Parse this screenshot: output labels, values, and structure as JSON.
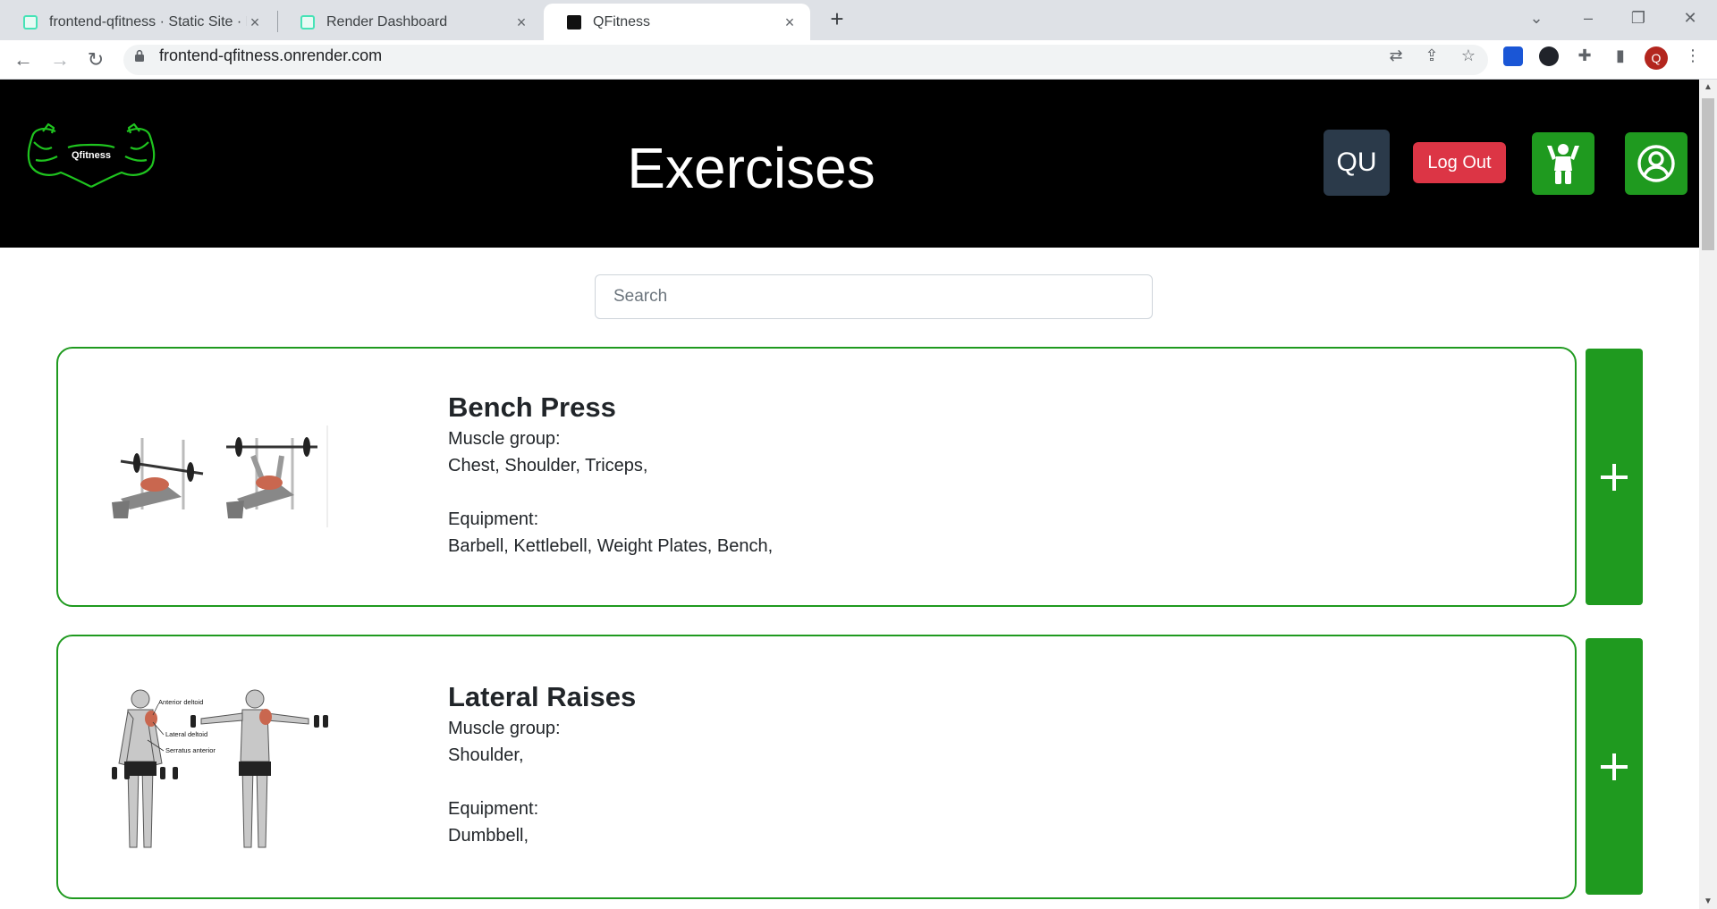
{
  "browser": {
    "tabs": [
      {
        "title": "frontend-qfitness · Static Site · R",
        "active": false
      },
      {
        "title": "Render Dashboard",
        "active": false
      },
      {
        "title": "QFitness",
        "active": true
      }
    ],
    "url": "frontend-qfitness.onrender.com",
    "profile_initial": "Q"
  },
  "header": {
    "logo_text": "Qfitness",
    "title": "Exercises",
    "user_initials": "QU",
    "logout_label": "Log Out"
  },
  "search": {
    "placeholder": "Search",
    "value": ""
  },
  "labels": {
    "muscle_group": "Muscle group:",
    "equipment": "Equipment:",
    "add": "+"
  },
  "exercises": [
    {
      "name": "Bench Press",
      "muscles": "Chest, Shoulder, Triceps,",
      "equipment": "Barbell, Kettlebell, Weight Plates, Bench,"
    },
    {
      "name": "Lateral Raises",
      "muscles": "Shoulder,",
      "equipment": "Dumbbell,",
      "image_labels": [
        "Anterior deltoid",
        "Lateral deltoid",
        "Serratus anterior"
      ]
    }
  ],
  "colors": {
    "brand_green": "#1f9a1f",
    "danger": "#dc3545",
    "header_bg": "#000000",
    "user_btn": "#2b3a4a"
  }
}
